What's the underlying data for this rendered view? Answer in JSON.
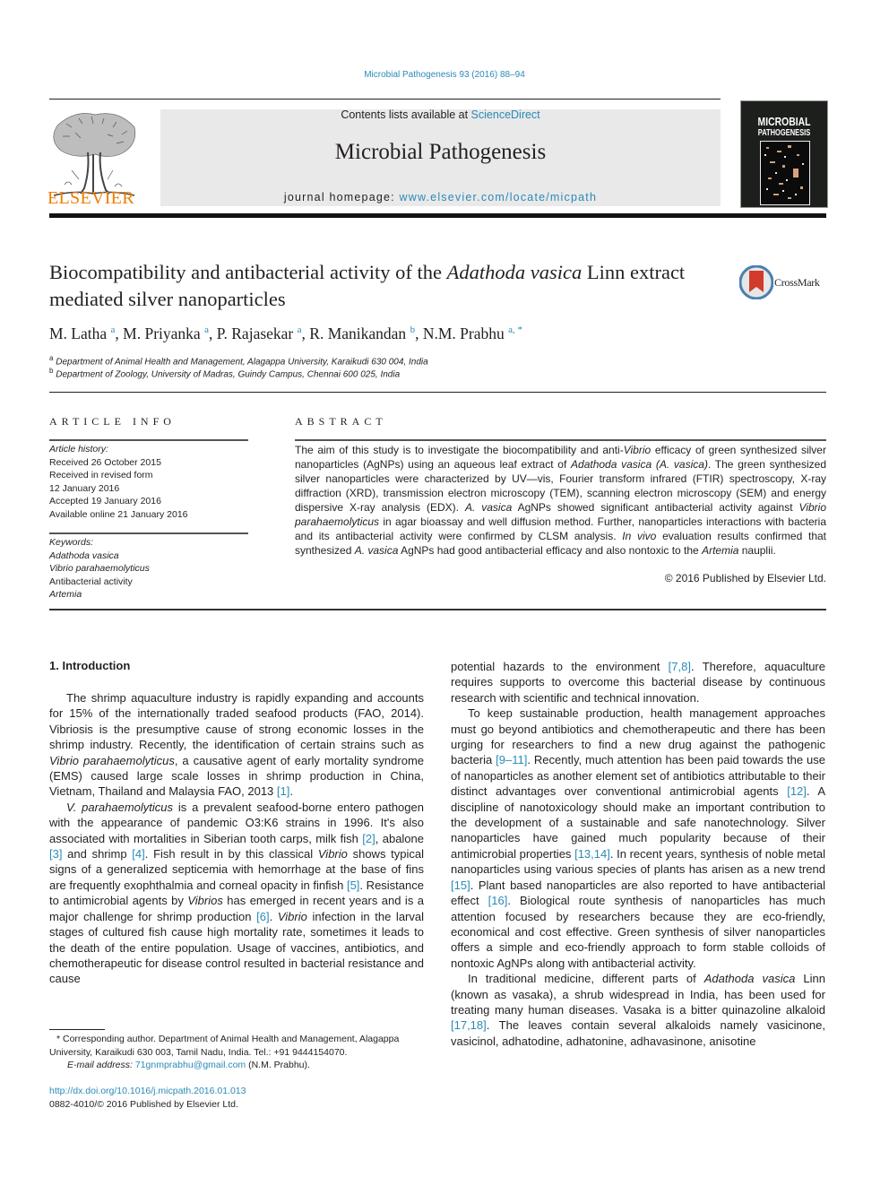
{
  "header": {
    "journal_ref": "Microbial Pathogenesis 93 (2016) 88–94",
    "contents_prefix": "Contents lists available at ",
    "contents_link": "ScienceDirect",
    "journal_title": "Microbial Pathogenesis",
    "homepage_prefix": "journal homepage: ",
    "homepage_link": "www.elsevier.com/locate/micpath",
    "publisher_logo_text": "ELSEVIER",
    "cover_title_line1": "MICROBIAL",
    "cover_title_line2": "PATHOGENESIS",
    "brand_color": "#f07c00",
    "link_color": "#2a8ab8"
  },
  "article": {
    "title_part1": "Biocompatibility and antibacterial activity of the ",
    "title_italic": "Adathoda vasica",
    "title_part2": " Linn extract mediated silver nanoparticles",
    "crossmark_label": "CrossMark",
    "authors": [
      {
        "name": "M. Latha",
        "sup": "a"
      },
      {
        "name": "M. Priyanka",
        "sup": "a"
      },
      {
        "name": "P. Rajasekar",
        "sup": "a"
      },
      {
        "name": "R. Manikandan",
        "sup": "b"
      },
      {
        "name": "N.M. Prabhu",
        "sup": "a, *"
      }
    ],
    "affiliations": [
      {
        "sup": "a",
        "text": "Department of Animal Health and Management, Alagappa University, Karaikudi 630 004, India"
      },
      {
        "sup": "b",
        "text": "Department of Zoology, University of Madras, Guindy Campus, Chennai 600 025, India"
      }
    ]
  },
  "article_info": {
    "heading": "ARTICLE INFO",
    "history_label": "Article history:",
    "history": [
      "Received 26 October 2015",
      "Received in revised form",
      "12 January 2016",
      "Accepted 19 January 2016",
      "Available online 21 January 2016"
    ],
    "keywords_label": "Keywords:",
    "keywords": [
      {
        "text": "Adathoda vasica",
        "italic": true
      },
      {
        "text": "Vibrio parahaemolyticus",
        "italic": true
      },
      {
        "text": "Antibacterial activity",
        "italic": false
      },
      {
        "text": "Artemia",
        "italic": true
      }
    ]
  },
  "abstract": {
    "heading": "ABSTRACT",
    "segments": [
      {
        "t": "The aim of this study is to investigate the biocompatibility and anti-"
      },
      {
        "t": "Vibrio",
        "i": true
      },
      {
        "t": " efficacy of green synthesized silver nanoparticles (AgNPs) using an aqueous leaf extract of "
      },
      {
        "t": "Adathoda vasica (A. vasica)",
        "i": true
      },
      {
        "t": ". The green synthesized silver nanoparticles were characterized by UV—vis, Fourier transform infrared (FTIR) spectroscopy, X-ray diffraction (XRD), transmission electron microscopy (TEM), scanning electron microscopy (SEM) and energy dispersive X-ray analysis (EDX). "
      },
      {
        "t": "A. vasica",
        "i": true
      },
      {
        "t": " AgNPs showed significant antibacterial activity against "
      },
      {
        "t": "Vibrio parahaemolyticus",
        "i": true
      },
      {
        "t": " in agar bioassay and well diffusion method. Further, nanoparticles interactions with bacteria and its antibacterial activity were confirmed by CLSM analysis. "
      },
      {
        "t": "In vivo",
        "i": true
      },
      {
        "t": " evaluation results confirmed that synthesized "
      },
      {
        "t": "A. vasica",
        "i": true
      },
      {
        "t": " AgNPs had good antibacterial efficacy and also nontoxic to the "
      },
      {
        "t": "Artemia",
        "i": true
      },
      {
        "t": " nauplii."
      }
    ],
    "copyright": "© 2016 Published by Elsevier Ltd."
  },
  "body": {
    "section_heading": "1.  Introduction",
    "left_paragraphs": [
      [
        {
          "t": "The shrimp aquaculture industry is rapidly expanding and accounts for 15% of the internationally traded seafood products (FAO, 2014). Vibriosis is the presumptive cause of strong economic losses in the shrimp industry. Recently, the identification of certain strains such as "
        },
        {
          "t": "Vibrio parahaemolyticus",
          "i": true
        },
        {
          "t": ", a causative agent of early mortality syndrome (EMS) caused large scale losses in shrimp production in China, Vietnam, Thailand and Malaysia FAO, 2013 "
        },
        {
          "t": "[1]",
          "ref": true
        },
        {
          "t": "."
        }
      ],
      [
        {
          "t": "V. parahaemolyticus",
          "i": true
        },
        {
          "t": " is a prevalent seafood-borne entero pathogen with the appearance of pandemic O3:K6 strains in 1996. It's also associated with mortalities in Siberian tooth carps, milk fish "
        },
        {
          "t": "[2]",
          "ref": true
        },
        {
          "t": ", abalone "
        },
        {
          "t": "[3]",
          "ref": true
        },
        {
          "t": " and shrimp "
        },
        {
          "t": "[4]",
          "ref": true
        },
        {
          "t": ". Fish result in by this classical "
        },
        {
          "t": "Vibrio",
          "i": true
        },
        {
          "t": " shows typical signs of a generalized septicemia with hemorrhage at the base of fins are frequently exophthalmia and corneal opacity in finfish "
        },
        {
          "t": "[5]",
          "ref": true
        },
        {
          "t": ". Resistance to antimicrobial agents by "
        },
        {
          "t": "Vibrios",
          "i": true
        },
        {
          "t": " has emerged in recent years and is a major challenge for shrimp production "
        },
        {
          "t": "[6]",
          "ref": true
        },
        {
          "t": ". "
        },
        {
          "t": "Vibrio",
          "i": true
        },
        {
          "t": " infection in the larval stages of cultured fish cause high mortality rate, sometimes it leads to the death of the entire population. Usage of vaccines, antibiotics, and chemotherapeutic for disease control resulted in bacterial resistance and cause"
        }
      ]
    ],
    "right_paragraphs": [
      [
        {
          "t": "potential hazards to the environment "
        },
        {
          "t": "[7,8]",
          "ref": true
        },
        {
          "t": ". Therefore, aquaculture requires supports to overcome this bacterial disease by continuous research with scientific and technical innovation."
        }
      ],
      [
        {
          "t": "To keep sustainable production, health management approaches must go beyond antibiotics and chemotherapeutic and there has been urging for researchers to find a new drug against the pathogenic bacteria "
        },
        {
          "t": "[9–11]",
          "ref": true
        },
        {
          "t": ". Recently, much attention has been paid towards the use of nanoparticles as another element set of antibiotics attributable to their distinct advantages over conventional antimicrobial agents "
        },
        {
          "t": "[12]",
          "ref": true
        },
        {
          "t": ". A discipline of nanotoxicology should make an important contribution to the development of a sustainable and safe nanotechnology. Silver nanoparticles have gained much popularity because of their antimicrobial properties "
        },
        {
          "t": "[13,14]",
          "ref": true
        },
        {
          "t": ". In recent years, synthesis of noble metal nanoparticles using various species of plants has arisen as a new trend "
        },
        {
          "t": "[15]",
          "ref": true
        },
        {
          "t": ". Plant based nanoparticles are also reported to have antibacterial effect "
        },
        {
          "t": "[16]",
          "ref": true
        },
        {
          "t": ". Biological route synthesis of nanoparticles has much attention focused by researchers because they are eco-friendly, economical and cost effective. Green synthesis of silver nanoparticles offers a simple and eco-friendly approach to form stable colloids of nontoxic AgNPs along with antibacterial activity."
        }
      ],
      [
        {
          "t": "In traditional medicine, different parts of "
        },
        {
          "t": "Adathoda vasica",
          "i": true
        },
        {
          "t": " Linn (known as vasaka), a shrub widespread in India, has been used for treating many human diseases. Vasaka is a bitter quinazoline alkaloid "
        },
        {
          "t": "[17,18]",
          "ref": true
        },
        {
          "t": ". The leaves contain several alkaloids namely vasicinone, vasicinol, adhatodine, adhatonine, adhavasinone, anisotine"
        }
      ]
    ]
  },
  "footnotes": {
    "corresponding": "* Corresponding author. Department of Animal Health and Management, Alagappa University, Karaikudi 630 003, Tamil Nadu, India. Tel.: +91 9444154070.",
    "email_label": "E-mail address: ",
    "email": "71gnmprabhu@gmail.com",
    "email_suffix": " (N.M. Prabhu).",
    "doi": "http://dx.doi.org/10.1016/j.micpath.2016.01.013",
    "issn_line": "0882-4010/© 2016 Published by Elsevier Ltd."
  }
}
